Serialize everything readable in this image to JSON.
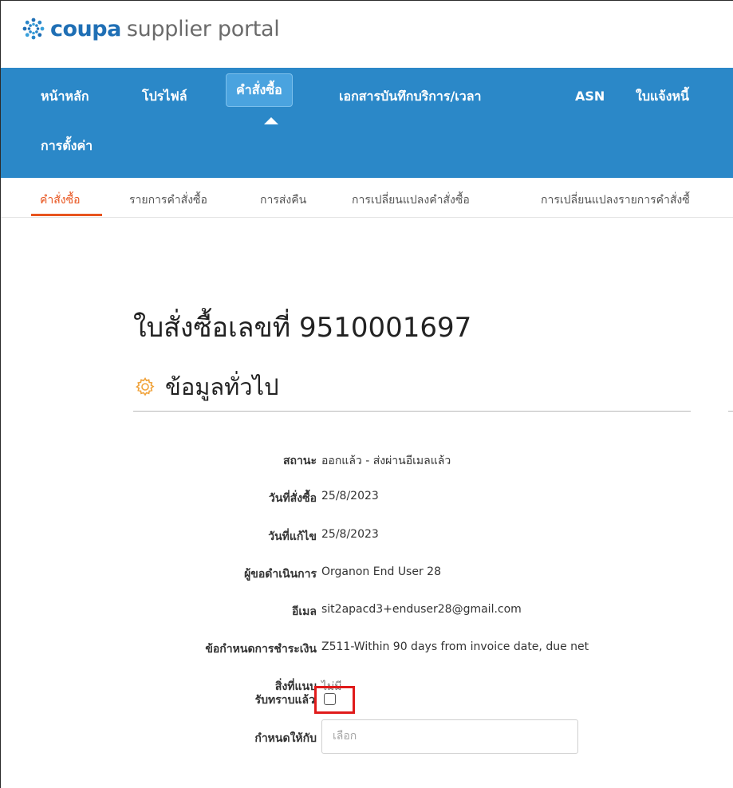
{
  "brand": {
    "logo_bold": "coupa",
    "logo_rest": "supplier portal",
    "accent": "#2b88c8",
    "highlight": "#e8541e"
  },
  "main_nav": {
    "items": [
      {
        "label": "หน้าหลัก"
      },
      {
        "label": "โปรไฟล์"
      },
      {
        "label": "คำสั่งซื้อ",
        "active": true
      },
      {
        "label": "เอกสารบันทึกบริการ/เวลา"
      },
      {
        "label": "ASN"
      },
      {
        "label": "ใบแจ้งหนี้"
      },
      {
        "label": "การตั้งค่า"
      }
    ]
  },
  "sub_nav": {
    "items": [
      {
        "label": "คำสั่งซื้อ",
        "active": true
      },
      {
        "label": "รายการคำสั่งซื้อ"
      },
      {
        "label": "การส่งคืน"
      },
      {
        "label": "การเปลี่ยนแปลงคำสั่งซื้อ"
      },
      {
        "label": "การเปลี่ยนแปลงรายการคำสั่งซื้"
      }
    ]
  },
  "page": {
    "title": "ใบสั่งซื้อเลขที่ 9510001697",
    "section_title": "ข้อมูลทั่วไป"
  },
  "details": [
    {
      "label": "สถานะ",
      "value": "ออกแล้ว - ส่งผ่านอีเมลแล้ว"
    },
    {
      "label": "วันที่สั่งซื้อ",
      "value": "25/8/2023"
    },
    {
      "label": "วันที่แก้ไข",
      "value": "25/8/2023"
    },
    {
      "label": "ผู้ขอดำเนินการ",
      "value": "Organon End User 28"
    },
    {
      "label": "อีเมล",
      "value": "sit2apacd3+enduser28@gmail.com"
    },
    {
      "label": "ข้อกำหนดการชำระเงิน",
      "value": "Z511-Within 90 days from invoice date, due net"
    },
    {
      "label": "สิ่งที่แนบ",
      "value": "ไม่มี"
    }
  ],
  "acknowledge": {
    "label": "รับทราบแล้ว",
    "checked": false
  },
  "assign_to": {
    "label": "กำหนดให้กับ",
    "placeholder": "เลือก"
  }
}
